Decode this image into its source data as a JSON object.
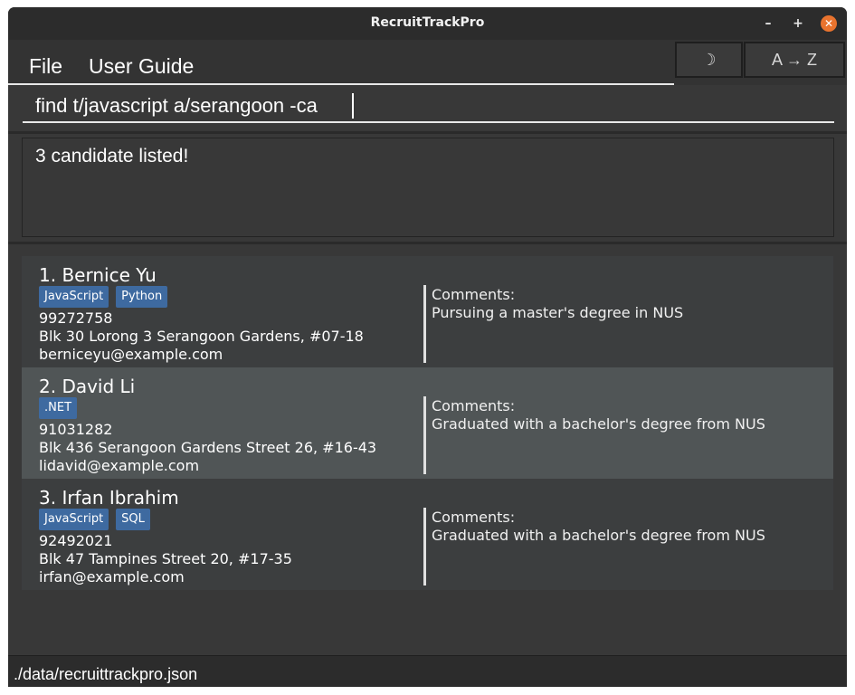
{
  "window": {
    "title": "RecruitTrackPro",
    "controls": {
      "minimize": "–",
      "maximize": "+",
      "close": "✕"
    }
  },
  "menu": {
    "file": "File",
    "user_guide": "User Guide"
  },
  "toolbar": {
    "theme_toggle": "☽",
    "sort": "A → Z"
  },
  "command": {
    "value": "find t/javascript a/serangoon -ca"
  },
  "result": {
    "message": "3 candidate listed!"
  },
  "candidates": [
    {
      "name": "1. Bernice Yu",
      "tags": [
        "JavaScript",
        "Python"
      ],
      "phone": "99272758",
      "address": "Blk 30 Lorong 3 Serangoon Gardens, #07-18",
      "email": "berniceyu@example.com",
      "comments_label": "Comments:",
      "comments": "Pursuing a master's degree in NUS"
    },
    {
      "name": "2. David Li",
      "tags": [
        ".NET"
      ],
      "phone": "91031282",
      "address": "Blk 436 Serangoon Gardens Street 26, #16-43",
      "email": "lidavid@example.com",
      "comments_label": "Comments:",
      "comments": "Graduated with a bachelor's degree from NUS"
    },
    {
      "name": "3. Irfan Ibrahim",
      "tags": [
        "JavaScript",
        "SQL"
      ],
      "phone": "92492021",
      "address": "Blk 47 Tampines Street 20, #17-35",
      "email": "irfan@example.com",
      "comments_label": "Comments:",
      "comments": "Graduated with a bachelor's degree from NUS"
    }
  ],
  "status": {
    "file_path": "./data/recruittrackpro.json"
  },
  "colors": {
    "window_bg": "#383838",
    "titlebar_bg": "#2c2c2c",
    "tag_bg": "#3e6aa0",
    "selected_card_bg": "#505556",
    "close_button": "#e9732e"
  }
}
